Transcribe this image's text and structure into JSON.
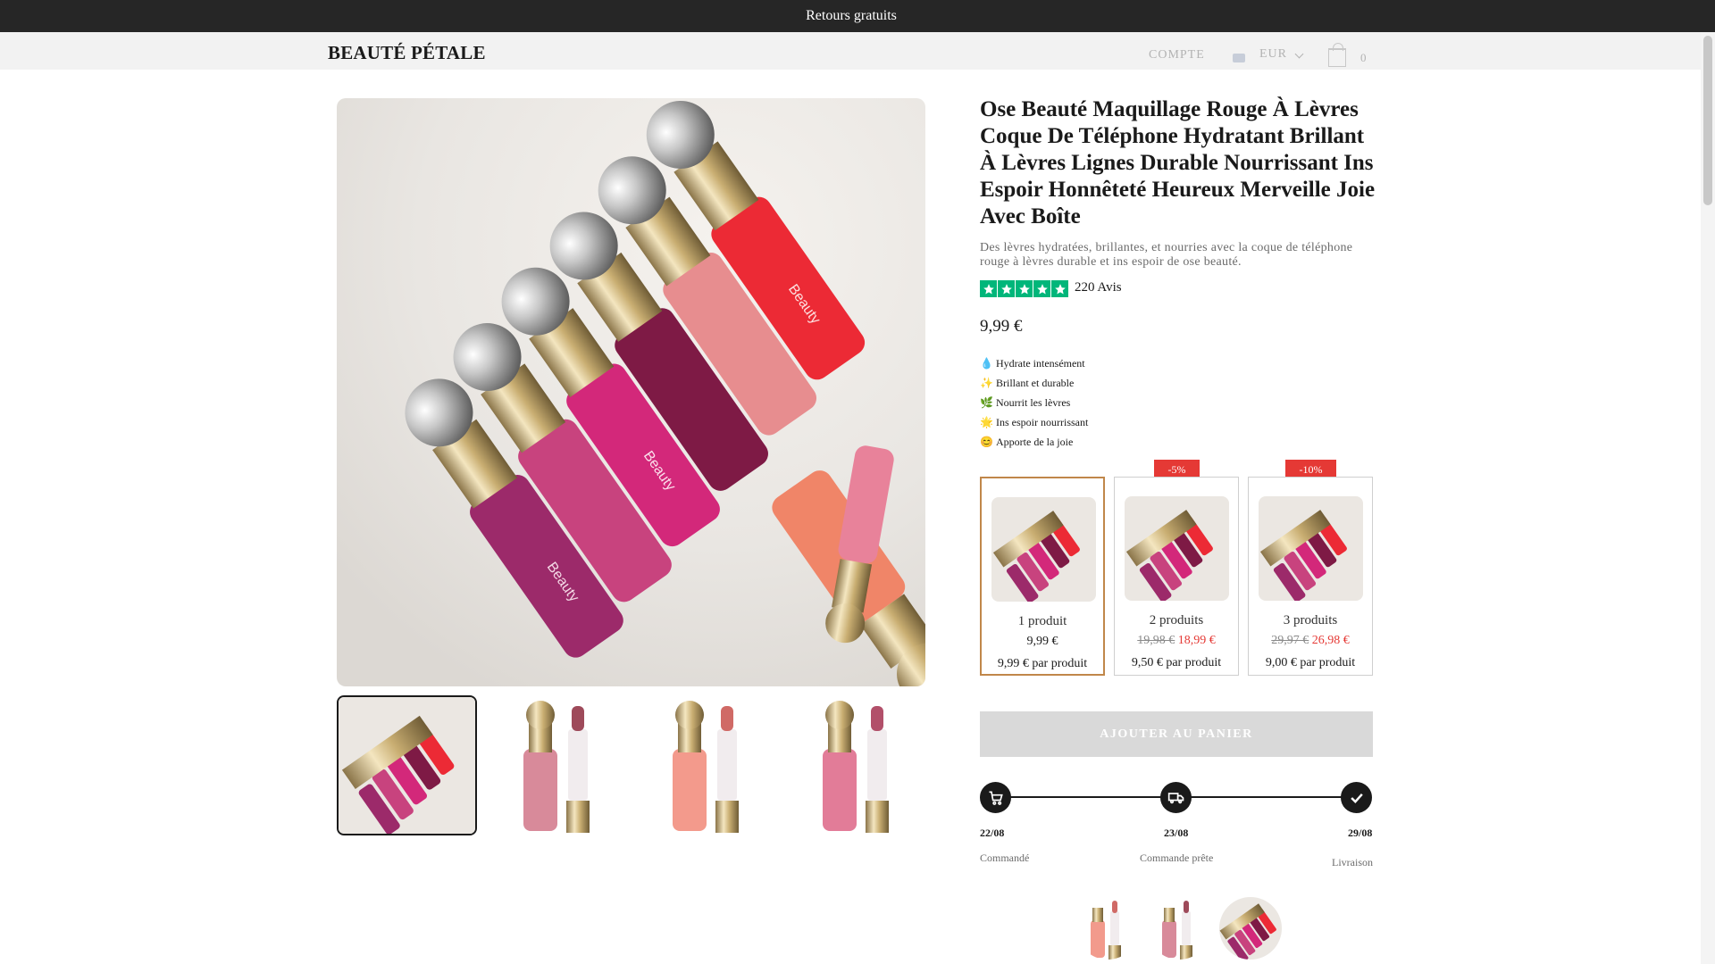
{
  "announcement": "Retours gratuits",
  "header": {
    "logo": "BEAUTÉ PÉTALE",
    "account": "COMPTE",
    "currency": "EUR",
    "cart_count": "0"
  },
  "product": {
    "title": "Ose Beauté Maquillage Rouge À Lèvres Coque De Téléphone Hydratant Brillant À Lèvres Lignes Durable Nourrissant Ins Espoir Honnêteté Heureux Merveille Joie Avec Boîte",
    "description": "Des lèvres hydratées, brillantes, et nourries avec la coque de téléphone rouge à lèvres durable et ins espoir de ose beauté.",
    "rating_stars": 5,
    "reviews": "220 Avis",
    "price": "9,99 €",
    "features": [
      {
        "icon": "💧",
        "text": "Hydrate intensément"
      },
      {
        "icon": "✨",
        "text": "Brillant et durable"
      },
      {
        "icon": "🌿",
        "text": "Nourrit les lèvres"
      },
      {
        "icon": "🌟",
        "text": "Ins espoir nourrissant"
      },
      {
        "icon": "😊",
        "text": "Apporte de la joie"
      }
    ]
  },
  "offers": [
    {
      "label": "1 produit",
      "price": "9,99 €",
      "per": "9,99 € par produit"
    },
    {
      "badge": "-5%",
      "label": "2 produits",
      "old": "19,98 €",
      "price": "18,99 €",
      "per": "9,50 € par produit"
    },
    {
      "badge": "-10%",
      "label": "3 produits",
      "old": "29,97 €",
      "price": "26,98 €",
      "per": "9,00 € par produit"
    }
  ],
  "add_to_cart": "AJOUTER AU PANIER",
  "tracking": [
    {
      "date": "22/08",
      "label": "Commandé",
      "icon": "cart-icon"
    },
    {
      "date": "23/08",
      "label": "Commande prête",
      "icon": "truck-icon"
    },
    {
      "date": "29/08",
      "label": "Livraison",
      "icon": "check-icon"
    }
  ],
  "colors": {
    "accent_green": "#00b67a",
    "sale_red": "#e53935",
    "selected_border": "#c0874a"
  }
}
